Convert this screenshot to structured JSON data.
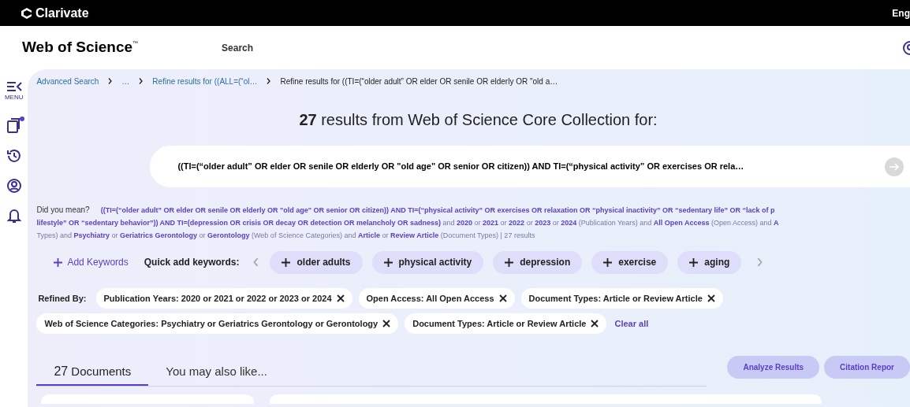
{
  "top_bar": {
    "brand": "Clarivate",
    "language": "Eng"
  },
  "header": {
    "product": "Web of Science",
    "trademark": "™",
    "nav_link": "Search"
  },
  "sidebar": {
    "items": [
      {
        "kind": "menu",
        "label": "MENU",
        "notification": false
      },
      {
        "kind": "saved",
        "notification": true
      },
      {
        "kind": "history",
        "notification": false
      },
      {
        "kind": "profile",
        "notification": false
      },
      {
        "kind": "alerts",
        "notification": false
      }
    ]
  },
  "breadcrumbs": [
    {
      "label": "Advanced Search",
      "link": true
    },
    {
      "label": "…",
      "link": true
    },
    {
      "label": "Refine results for ((ALL=(“ol…",
      "link": true
    },
    {
      "label": "Refine results for ((TI=(“older adult” OR elder OR senile OR elderly OR \"old a…",
      "link": false
    }
  ],
  "results_heading": "**27** results from Web of Science Core Collection for:",
  "query": {
    "value": "((TI=(“older adult” OR elder OR senile OR elderly OR \"old age\" OR senior OR citizen)) AND TI=(“physical activity” OR exercises OR rela…"
  },
  "did_you_mean": {
    "label": "Did you mean?",
    "lines": [
      "**((TI=(“older adult” OR elder OR senile OR elderly OR \"old age\" OR senior OR citizen)) AND TI=(“physical activity” OR exercises OR relaxation OR “physical inactivity” OR “sedentary life” OR “lack of p**",
      "**lifestyle” OR “sedentary behavior”)) AND TI=(depression OR crisis OR decay OR detection OR melancholy OR sadness)** and **2020** or **2021** or **2022** or **2023** or **2024** (Publication Years) and **All Open Access** (Open Access) and **A**",
      "Types) and **Psychiatry** or **Geriatrics Gerontology** or **Gerontology** (Web of Science Categories) and **Article** or **Review Article** (Document Types) | 27 results"
    ]
  },
  "keywords": {
    "add_label": "Add Keywords",
    "quick_label": "Quick add keywords:",
    "chips": [
      "older adults",
      "physical activity",
      "depression",
      "exercise",
      "aging"
    ]
  },
  "refined_by": {
    "label": "Refined By:",
    "filters": [
      "Publication Years: 2020 or 2021 or 2022 or 2023 or 2024",
      "Open Access: All Open Access",
      "Document Types: Article or Review Article",
      "Web of Science Categories: Psychiatry or Geriatrics Gerontology or Gerontology",
      "Document Types: Article or Review Article"
    ],
    "clear_label": "Clear all"
  },
  "tabs": [
    {
      "label": "**27** Documents",
      "selected": true
    },
    {
      "label": "You may also like...",
      "selected": false
    }
  ],
  "actions": [
    "Analyze Results",
    "Citation Repor"
  ]
}
